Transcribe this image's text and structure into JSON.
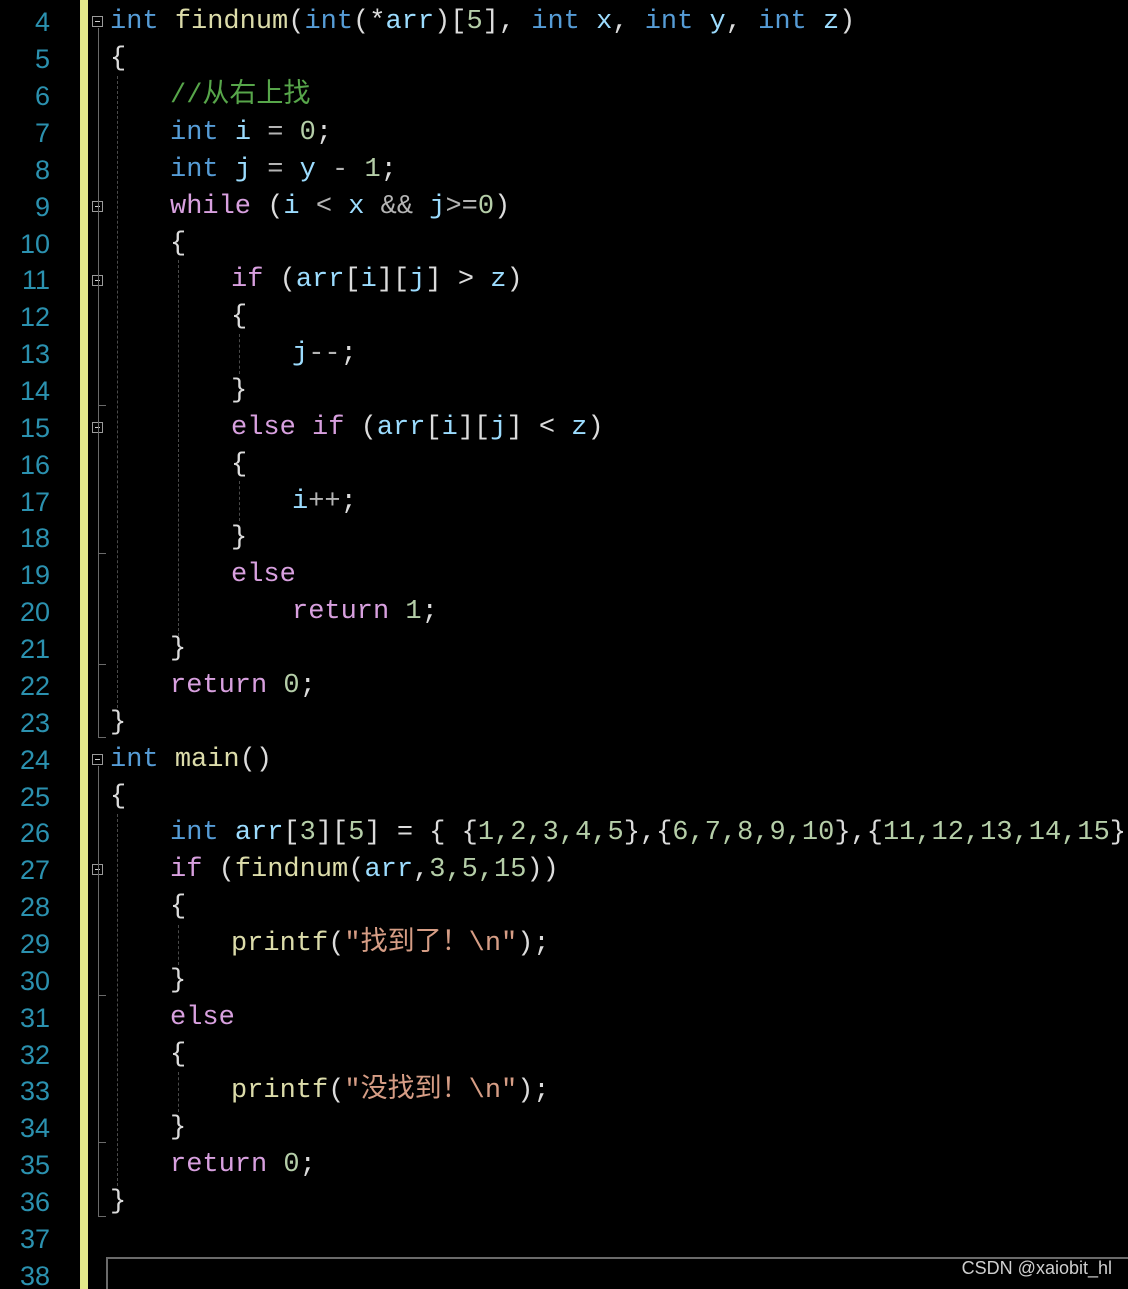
{
  "editor": {
    "line_numbers": [
      "4",
      "5",
      "6",
      "7",
      "8",
      "9",
      "10",
      "11",
      "12",
      "13",
      "14",
      "15",
      "16",
      "17",
      "18",
      "19",
      "20",
      "21",
      "22",
      "23",
      "24",
      "25",
      "26",
      "27",
      "28",
      "29",
      "30",
      "31",
      "32",
      "33",
      "34",
      "35",
      "36",
      "37",
      "38"
    ],
    "colors": {
      "background": "#000000",
      "line_number": "#2b91af",
      "keyword": "#569cd6",
      "control": "#d8a0df",
      "function": "#dcdcaa",
      "variable": "#9cdcfe",
      "number": "#b5cea8",
      "comment": "#57a64a",
      "string": "#d69d85",
      "change_bar": "#e3e88a"
    },
    "code": {
      "l4": {
        "kw1": "int",
        "fn": "findnum",
        "p1": "(",
        "kw2": "int",
        "p2": "(*",
        "v1": "arr",
        "p3": ")[",
        "n1": "5",
        "p4": "],",
        "kw3": "int",
        "v2": "x",
        ",1": ",",
        "kw4": "int",
        "v3": "y",
        ",2": ",",
        "kw5": "int",
        "v4": "z",
        "p5": ")"
      },
      "l5": {
        "t": "{"
      },
      "l6": {
        "cm": "//从右上找"
      },
      "l7": {
        "kw": "int",
        "v": "i",
        "op": " = ",
        "n": "0",
        "e": ";"
      },
      "l8": {
        "kw": "int",
        "v": "j",
        "op": " = ",
        "v2": "y",
        "op2": " - ",
        "n": "1",
        "e": ";"
      },
      "l9": {
        "ctl": "while",
        "p1": " (",
        "v1": "i",
        "op1": " < ",
        "v2": "x",
        "op2": " && ",
        "v3": "j",
        "op3": ">=",
        "n": "0",
        "p2": ")"
      },
      "l10": {
        "t": "{"
      },
      "l11": {
        "ctl": "if",
        "p1": " (",
        "v1": "arr",
        "p2": "[",
        "v2": "i",
        "p3": "][",
        "v3": "j",
        "p4": "] > ",
        "v4": "z",
        "p5": ")"
      },
      "l12": {
        "t": "{"
      },
      "l13": {
        "v": "j",
        "op": "--",
        "e": ";"
      },
      "l14": {
        "t": "}"
      },
      "l15": {
        "ctl1": "else",
        "ctl2": "if",
        "p1": " (",
        "v1": "arr",
        "p2": "[",
        "v2": "i",
        "p3": "][",
        "v3": "j",
        "p4": "] < ",
        "v4": "z",
        "p5": ")"
      },
      "l16": {
        "t": "{"
      },
      "l17": {
        "v": "i",
        "op": "++",
        "e": ";"
      },
      "l18": {
        "t": "}"
      },
      "l19": {
        "ctl": "else"
      },
      "l20": {
        "ctl": "return",
        "n": "1",
        "e": ";"
      },
      "l21": {
        "t": "}"
      },
      "l22": {
        "ctl": "return",
        "n": "0",
        "e": ";"
      },
      "l23": {
        "t": "}"
      },
      "l24": {
        "kw": "int",
        "fn": "main",
        "p": "()"
      },
      "l25": {
        "t": "{"
      },
      "l26": {
        "kw": "int",
        "v": "arr",
        "p1": "[",
        "n1": "3",
        "p2": "][",
        "n2": "5",
        "p3": "] = { {",
        "a1": "1,2,3,4,5",
        "p4": "},{",
        "a2": "6,7,8,9,10",
        "p5": "},{",
        "a3": "11,12,13,14,15",
        "p6": "} };"
      },
      "l27": {
        "ctl": "if",
        "p1": " (",
        "fn": "findnum",
        "p2": "(",
        "v": "arr",
        "p3": ",",
        "a": "3,5,15",
        "p4": "))"
      },
      "l28": {
        "t": "{"
      },
      "l29": {
        "fn": "printf",
        "p1": "(",
        "s": "\"找到了！\\n\"",
        "p2": ");"
      },
      "l30": {
        "t": "}"
      },
      "l31": {
        "ctl": "else"
      },
      "l32": {
        "t": "{"
      },
      "l33": {
        "fn": "printf",
        "p1": "(",
        "s": "\"没找到！\\n\"",
        "p2": ");"
      },
      "l34": {
        "t": "}"
      },
      "l35": {
        "ctl": "return",
        "n": "0",
        "e": ";"
      },
      "l36": {
        "t": "}"
      }
    }
  },
  "watermark": "CSDN @xaiobit_hl"
}
